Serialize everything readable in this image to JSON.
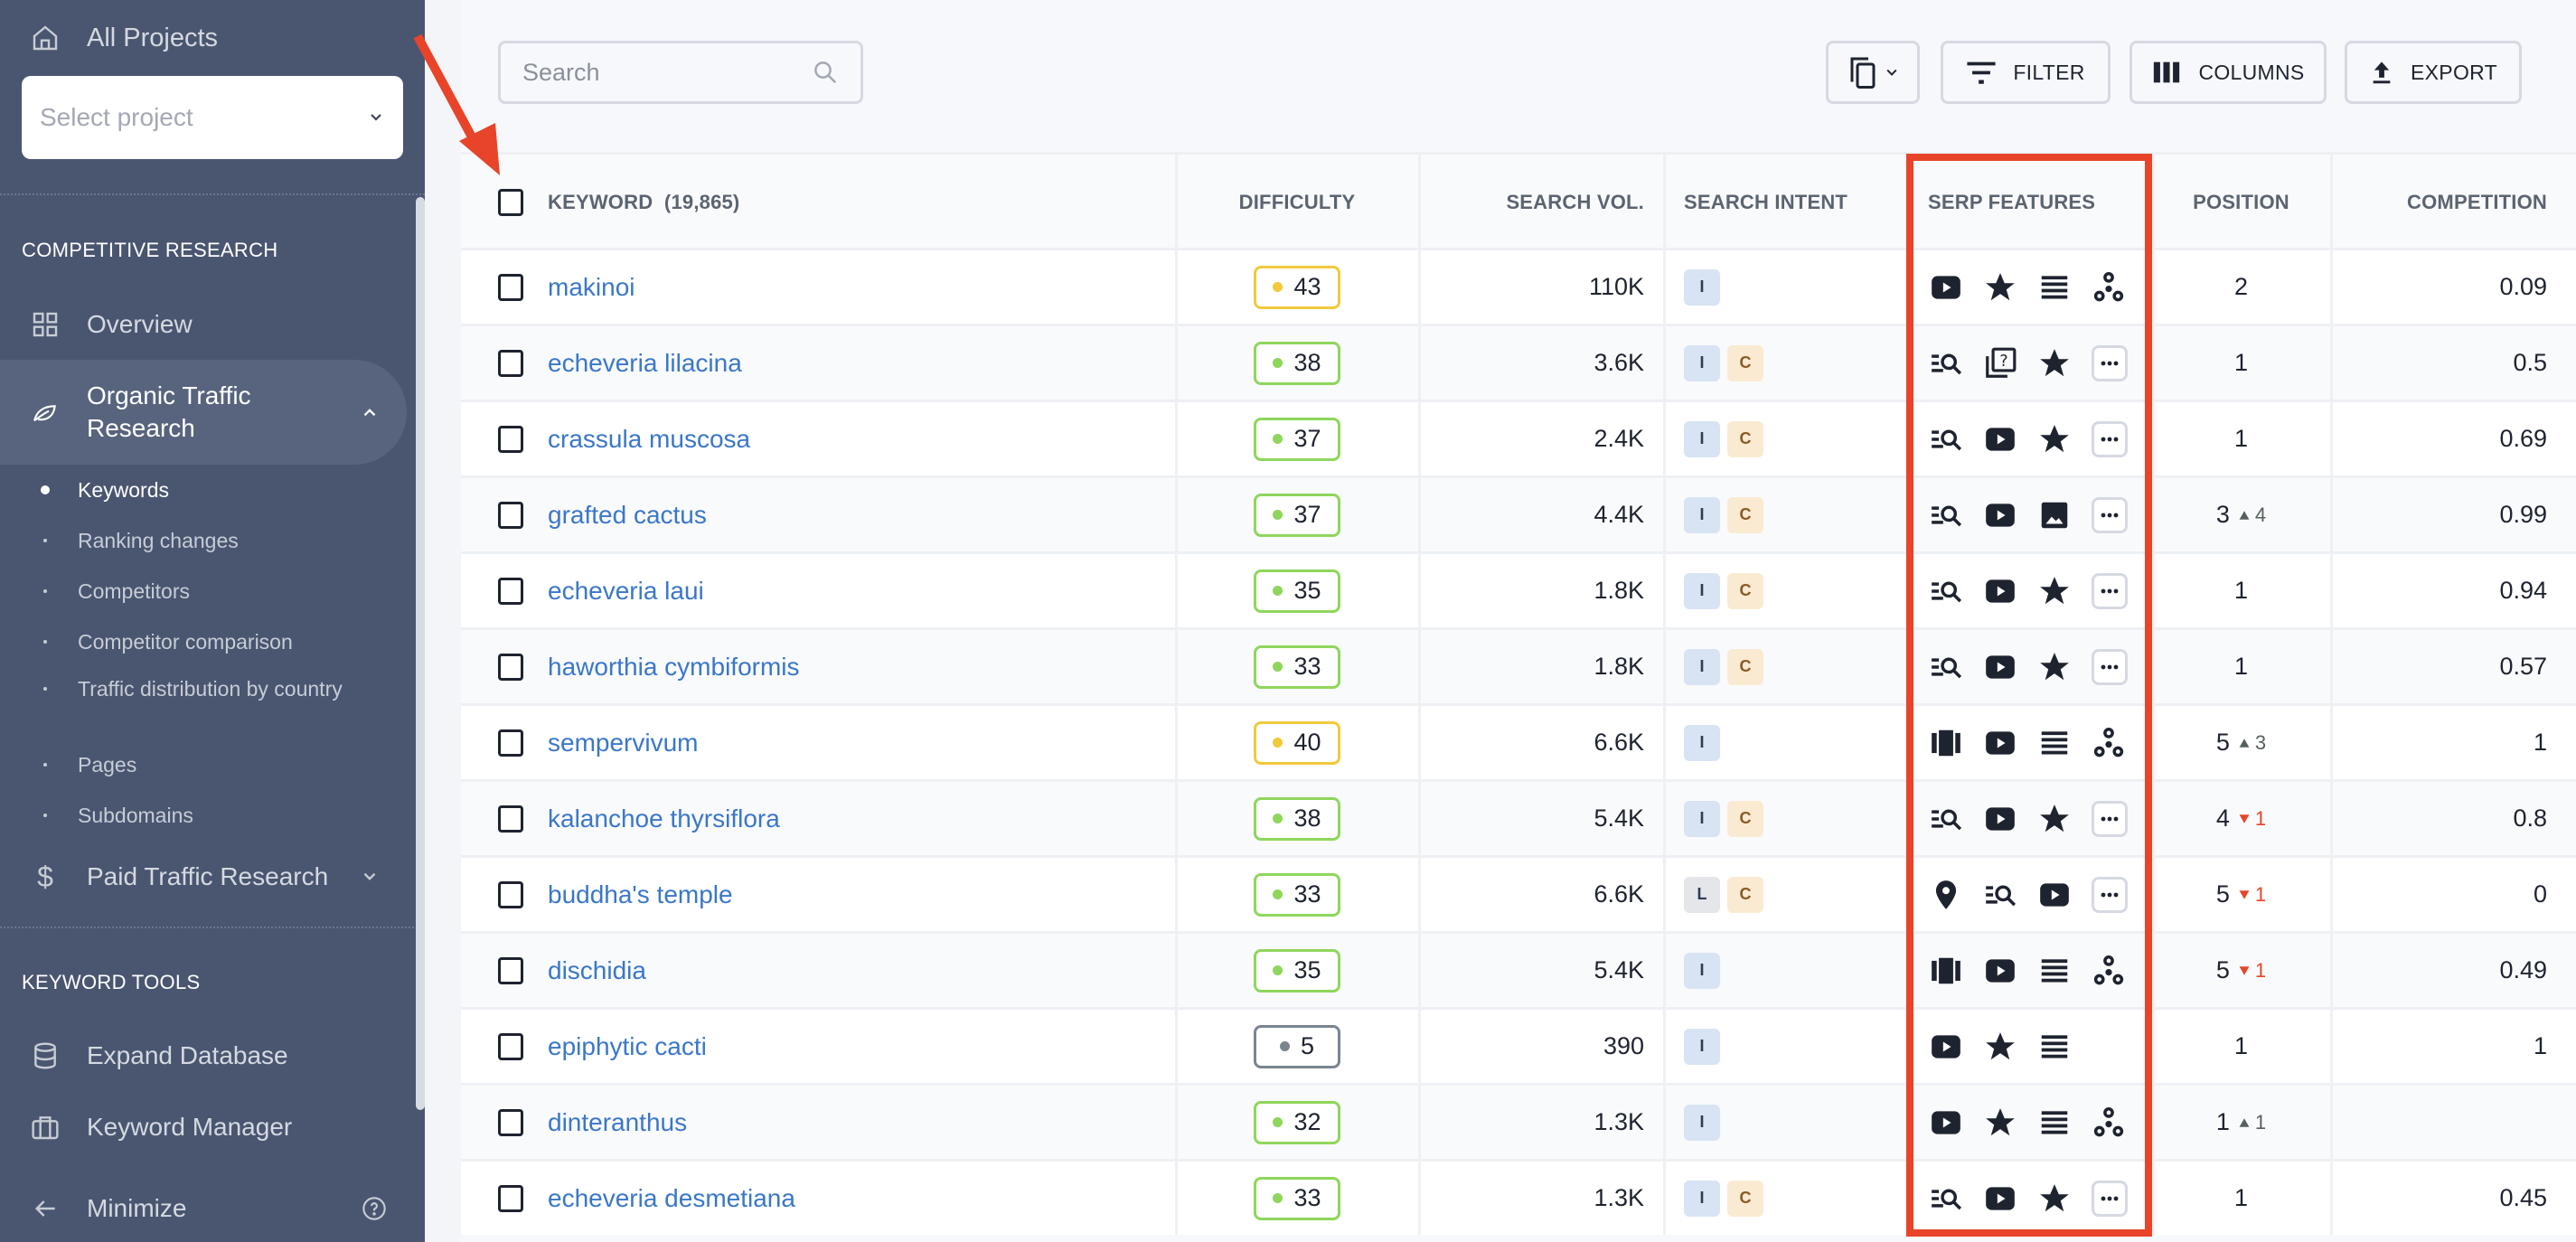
{
  "sidebar": {
    "all_projects": "All Projects",
    "project_select_placeholder": "Select project",
    "section_competitive": "COMPETITIVE RESEARCH",
    "overview": "Overview",
    "organic": "Organic Traffic Research",
    "organic_line1": "Organic Traffic",
    "organic_line2": "Research",
    "subitems": [
      "Keywords",
      "Ranking changes",
      "Competitors",
      "Competitor comparison",
      "Traffic distribution by country",
      "Pages",
      "Subdomains"
    ],
    "paid": "Paid Traffic Research",
    "section_keyword_tools": "KEYWORD TOOLS",
    "expand_db": "Expand Database",
    "keyword_manager": "Keyword Manager",
    "minimize": "Minimize"
  },
  "toolbar": {
    "search_placeholder": "Search",
    "filter": "FILTER",
    "columns": "COLUMNS",
    "export": "EXPORT"
  },
  "table": {
    "headers": {
      "keyword": "KEYWORD",
      "keyword_count": "(19,865)",
      "difficulty": "DIFFICULTY",
      "search_vol": "SEARCH VOL.",
      "search_intent": "SEARCH INTENT",
      "serp_features": "SERP FEATURES",
      "position": "POSITION",
      "competition": "COMPETITION"
    },
    "rows": [
      {
        "keyword": "makinoi",
        "difficulty": "43",
        "level": "medium",
        "volume": "110K",
        "intent": [
          "I"
        ],
        "serp": [
          "video",
          "reviews",
          "list",
          "knowledge"
        ],
        "position": "2",
        "delta": "",
        "dir": "",
        "competition": "0.09"
      },
      {
        "keyword": "echeveria lilacina",
        "difficulty": "38",
        "level": "easy",
        "volume": "3.6K",
        "intent": [
          "I",
          "C"
        ],
        "serp": [
          "related-search",
          "faq",
          "reviews",
          "more"
        ],
        "position": "1",
        "delta": "",
        "dir": "",
        "competition": "0.5"
      },
      {
        "keyword": "crassula muscosa",
        "difficulty": "37",
        "level": "easy",
        "volume": "2.4K",
        "intent": [
          "I",
          "C"
        ],
        "serp": [
          "related-search",
          "video",
          "reviews",
          "more"
        ],
        "position": "1",
        "delta": "",
        "dir": "",
        "competition": "0.69"
      },
      {
        "keyword": "grafted cactus",
        "difficulty": "37",
        "level": "easy",
        "volume": "4.4K",
        "intent": [
          "I",
          "C"
        ],
        "serp": [
          "related-search",
          "video",
          "image",
          "more"
        ],
        "position": "3",
        "delta": "4",
        "dir": "up",
        "competition": "0.99"
      },
      {
        "keyword": "echeveria laui",
        "difficulty": "35",
        "level": "easy",
        "volume": "1.8K",
        "intent": [
          "I",
          "C"
        ],
        "serp": [
          "related-search",
          "video",
          "reviews",
          "more"
        ],
        "position": "1",
        "delta": "",
        "dir": "",
        "competition": "0.94"
      },
      {
        "keyword": "haworthia cymbiformis",
        "difficulty": "33",
        "level": "easy",
        "volume": "1.8K",
        "intent": [
          "I",
          "C"
        ],
        "serp": [
          "related-search",
          "video",
          "reviews",
          "more"
        ],
        "position": "1",
        "delta": "",
        "dir": "",
        "competition": "0.57"
      },
      {
        "keyword": "sempervivum",
        "difficulty": "40",
        "level": "medium",
        "volume": "6.6K",
        "intent": [
          "I"
        ],
        "serp": [
          "carousel",
          "video",
          "list",
          "knowledge"
        ],
        "position": "5",
        "delta": "3",
        "dir": "up",
        "competition": "1"
      },
      {
        "keyword": "kalanchoe thyrsiflora",
        "difficulty": "38",
        "level": "easy",
        "volume": "5.4K",
        "intent": [
          "I",
          "C"
        ],
        "serp": [
          "related-search",
          "video",
          "reviews",
          "more"
        ],
        "position": "4",
        "delta": "1",
        "dir": "down",
        "competition": "0.8"
      },
      {
        "keyword": "buddha's temple",
        "difficulty": "33",
        "level": "easy",
        "volume": "6.6K",
        "intent": [
          "L",
          "C"
        ],
        "serp": [
          "local-pack",
          "related-search",
          "video",
          "more"
        ],
        "position": "5",
        "delta": "1",
        "dir": "down",
        "competition": "0"
      },
      {
        "keyword": "dischidia",
        "difficulty": "35",
        "level": "easy",
        "volume": "5.4K",
        "intent": [
          "I"
        ],
        "serp": [
          "carousel",
          "video",
          "list",
          "knowledge"
        ],
        "position": "5",
        "delta": "1",
        "dir": "down",
        "competition": "0.49"
      },
      {
        "keyword": "epiphytic cacti",
        "difficulty": "5",
        "level": "very-easy",
        "volume": "390",
        "intent": [
          "I"
        ],
        "serp": [
          "video",
          "reviews",
          "list"
        ],
        "position": "1",
        "delta": "",
        "dir": "",
        "competition": "1"
      },
      {
        "keyword": "dinteranthus",
        "difficulty": "32",
        "level": "easy",
        "volume": "1.3K",
        "intent": [
          "I"
        ],
        "serp": [
          "video",
          "reviews",
          "list",
          "knowledge"
        ],
        "position": "1",
        "delta": "1",
        "dir": "up",
        "competition": ""
      },
      {
        "keyword": "echeveria desmetiana",
        "difficulty": "33",
        "level": "easy",
        "volume": "1.3K",
        "intent": [
          "I",
          "C"
        ],
        "serp": [
          "related-search",
          "video",
          "reviews",
          "more"
        ],
        "position": "1",
        "delta": "",
        "dir": "",
        "competition": "0.45"
      }
    ]
  },
  "colors": {
    "sidebar_bg": "#4a5670",
    "link": "#3a77c8",
    "difficulty_easy": "#8fd65c",
    "difficulty_medium": "#f2c93c",
    "difficulty_very_easy": "#7a8590",
    "intent_I_bg": "#d8e4f4",
    "intent_C_bg": "#fbead2",
    "intent_L_bg": "#e4e6ea",
    "delta_up": "#56605c",
    "delta_down": "#e8442a",
    "annotation": "#e8442a",
    "chat": "#3a78cc"
  }
}
